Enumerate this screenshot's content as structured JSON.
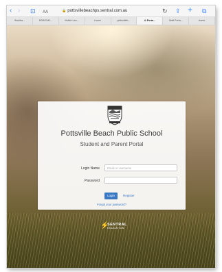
{
  "browser": {
    "back_icon": "‹",
    "forward_icon": "›",
    "bookmarks_icon": "⊡",
    "reader_label": "AA",
    "url": "pottsvillebeachps.sentral.com.au",
    "lock_icon": "🔒",
    "reload_icon": "↻",
    "share_icon": "⇪",
    "new_tab_icon": "+",
    "tabs_icon": "⧉",
    "tabs": [
      {
        "label": "Studiba..."
      },
      {
        "label": "NSW EdE..."
      },
      {
        "label": "Visible Lea..."
      },
      {
        "label": "Home"
      },
      {
        "label": "pottsvilleb..."
      },
      {
        "label": "⊙ Porta..."
      },
      {
        "label": "Staff Porta..."
      },
      {
        "label": "Home"
      }
    ]
  },
  "login": {
    "school_name": "Pottsville Beach Public School",
    "portal_name": "Student and Parent Portal",
    "login_name_label": "Login Name",
    "login_name_placeholder": "Email or username",
    "password_label": "Password",
    "password_placeholder": "",
    "login_button": "Login",
    "register_link": "Register",
    "forgot_link": "Forgot your password?"
  },
  "footer": {
    "brand": "SENTRAL",
    "brand_sub": "EDUCATION",
    "brand_mark": "⚡"
  },
  "colors": {
    "accent": "#3a78c4",
    "safari_blue": "#3b82f6"
  }
}
